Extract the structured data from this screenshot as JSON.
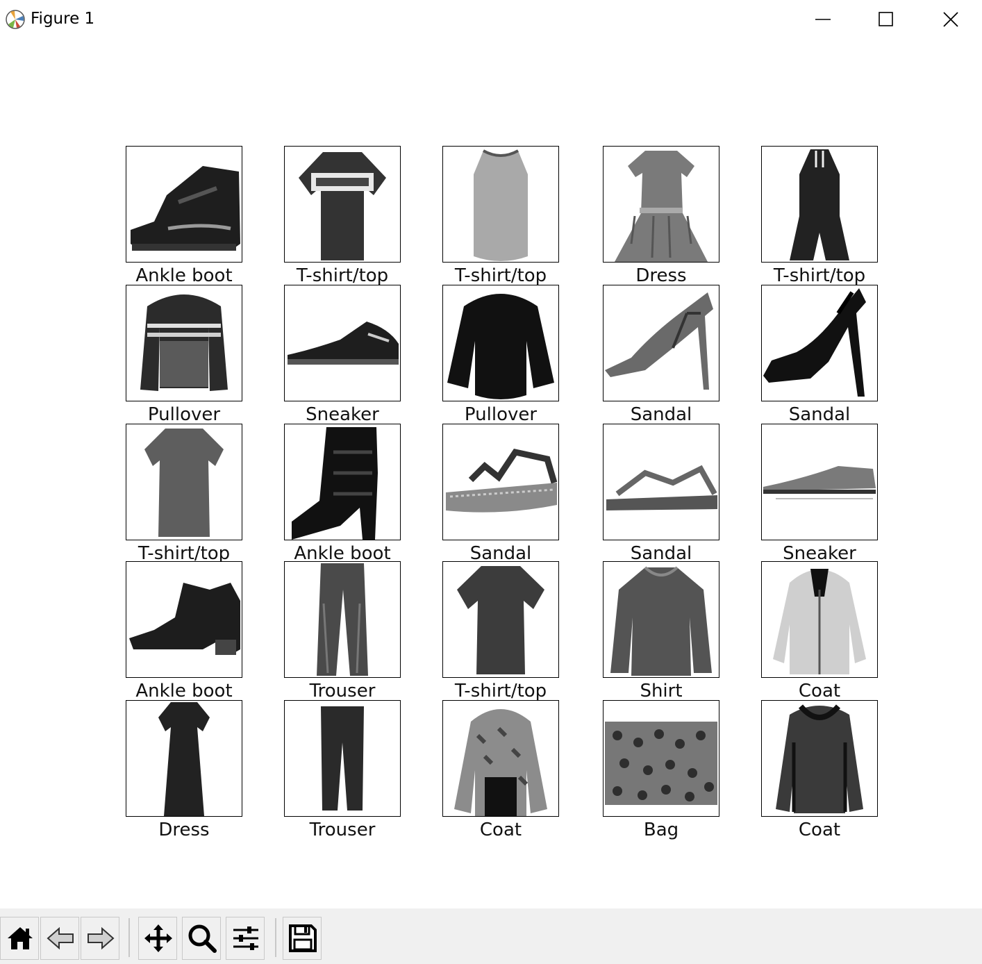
{
  "window": {
    "title": "Figure 1",
    "icons": {
      "app": "matplotlib-icon",
      "minimize": "minimize-icon",
      "maximize": "maximize-icon",
      "close": "close-icon"
    }
  },
  "figure": {
    "grid": {
      "rows": 5,
      "columns": 5
    },
    "items": [
      {
        "label": "Ankle boot",
        "icon": "ankle-boot"
      },
      {
        "label": "T-shirt/top",
        "icon": "tshirt-print"
      },
      {
        "label": "T-shirt/top",
        "icon": "tank-top"
      },
      {
        "label": "Dress",
        "icon": "dress"
      },
      {
        "label": "T-shirt/top",
        "icon": "romper"
      },
      {
        "label": "Pullover",
        "icon": "striped-pullover"
      },
      {
        "label": "Sneaker",
        "icon": "sneaker"
      },
      {
        "label": "Pullover",
        "icon": "pullover"
      },
      {
        "label": "Sandal",
        "icon": "heel-sandal"
      },
      {
        "label": "Sandal",
        "icon": "heel-sandal-dark"
      },
      {
        "label": "T-shirt/top",
        "icon": "long-tshirt"
      },
      {
        "label": "Ankle boot",
        "icon": "heel-boot"
      },
      {
        "label": "Sandal",
        "icon": "platform-sandal"
      },
      {
        "label": "Sandal",
        "icon": "flat-sandal"
      },
      {
        "label": "Sneaker",
        "icon": "low-sneaker"
      },
      {
        "label": "Ankle boot",
        "icon": "chelsea-boot"
      },
      {
        "label": "Trouser",
        "icon": "jeans"
      },
      {
        "label": "T-shirt/top",
        "icon": "tshirt"
      },
      {
        "label": "Shirt",
        "icon": "blouse"
      },
      {
        "label": "Coat",
        "icon": "light-hoodie"
      },
      {
        "label": "Dress",
        "icon": "dark-dress"
      },
      {
        "label": "Trouser",
        "icon": "trousers"
      },
      {
        "label": "Coat",
        "icon": "patterned-jacket"
      },
      {
        "label": "Bag",
        "icon": "patterned-bag"
      },
      {
        "label": "Coat",
        "icon": "dark-hoodie"
      }
    ]
  },
  "toolbar": {
    "buttons": [
      {
        "name": "home-button",
        "icon": "home-icon"
      },
      {
        "name": "back-button",
        "icon": "back-arrow-icon"
      },
      {
        "name": "forward-button",
        "icon": "forward-arrow-icon"
      },
      {
        "name": "pan-button",
        "icon": "move-icon"
      },
      {
        "name": "zoom-button",
        "icon": "magnifier-icon"
      },
      {
        "name": "configure-subplots-button",
        "icon": "sliders-icon"
      },
      {
        "name": "save-button",
        "icon": "floppy-disk-icon"
      }
    ]
  }
}
